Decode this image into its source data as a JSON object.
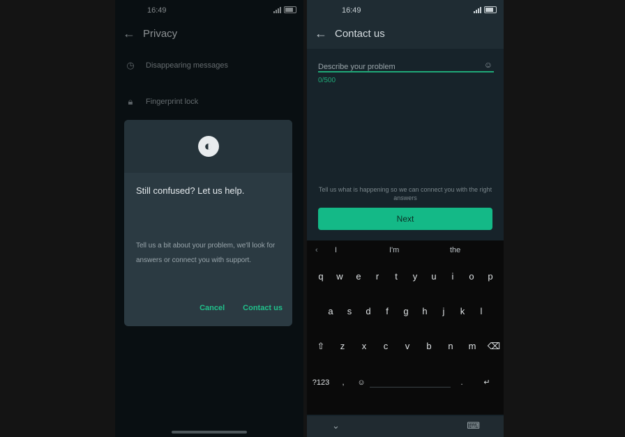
{
  "left_phone": {
    "status": {
      "time": "16:49"
    },
    "title": "Privacy",
    "settings": [
      {
        "icon": "clock-icon",
        "glyph": "◷",
        "label": "Disappearing messages"
      },
      {
        "icon": "lock-icon",
        "glyph": "🔒︎",
        "label": "Fingerprint lock"
      }
    ],
    "dialog": {
      "title": "Still confused? Let us help.",
      "body": "Tell us a bit about your problem, we'll look for answers or connect you with support.",
      "cancel": "Cancel",
      "confirm": "Contact us"
    }
  },
  "right_phone": {
    "status": {
      "time": "16:49"
    },
    "title": "Contact us",
    "field": {
      "label": "Describe your problem",
      "counter": "0/500"
    },
    "hint": "Tell us what is happening so we can connect you with the right answers",
    "send": "Next",
    "keyboard": {
      "suggestions": [
        "I",
        "I'm",
        "the"
      ],
      "rows": [
        [
          "q",
          "w",
          "e",
          "r",
          "t",
          "y",
          "u",
          "i",
          "o",
          "p"
        ],
        [
          "a",
          "s",
          "d",
          "f",
          "g",
          "h",
          "j",
          "k",
          "l"
        ],
        [
          "⇧",
          "z",
          "x",
          "c",
          "v",
          "b",
          "n",
          "m",
          "⌫"
        ],
        [
          "?123",
          ",",
          "☺︎",
          "space",
          ".",
          "↵"
        ]
      ]
    },
    "nav": {
      "left": "⌄",
      "right": "⌨"
    }
  },
  "colors": {
    "accent": "#14b987",
    "background": "#141414"
  }
}
